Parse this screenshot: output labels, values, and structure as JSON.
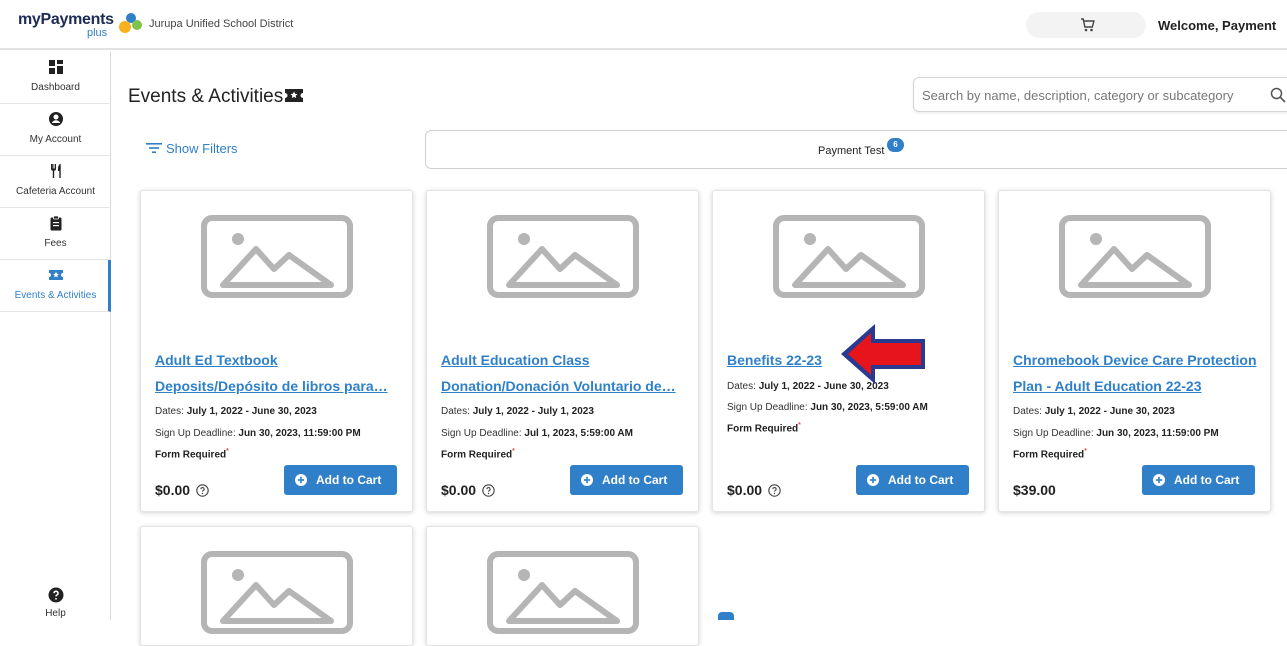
{
  "header": {
    "logo_text": "myPayments",
    "logo_sub": "plus",
    "district": "Jurupa Unified School District",
    "welcome": "Welcome, Payment",
    "cart_icon": "cart-icon"
  },
  "sidebar": {
    "items": [
      {
        "label": "Dashboard",
        "icon": "dashboard-icon"
      },
      {
        "label": "My Account",
        "icon": "user-icon"
      },
      {
        "label": "Cafeteria Account",
        "icon": "utensils-icon"
      },
      {
        "label": "Fees",
        "icon": "clipboard-icon"
      },
      {
        "label": "Events & Activities",
        "icon": "ticket-icon"
      }
    ],
    "help_label": "Help"
  },
  "main": {
    "title": "Events & Activities",
    "search_placeholder": "Search by name, description, category or subcategory",
    "filters_label": "Show Filters",
    "tab": {
      "label": "Payment Test",
      "count": "6"
    }
  },
  "cards": [
    {
      "title_line1": "Adult Ed Textbook",
      "title_line2": "Deposits/Depósito de libros para…",
      "dates_label": "Dates:",
      "dates": "July 1, 2022 - June 30, 2023",
      "deadline_label": "Sign Up Deadline:",
      "deadline": "Jun 30, 2023, 11:59:00 PM",
      "form": "Form Required",
      "price": "$0.00",
      "button": "Add to Cart"
    },
    {
      "title_line1": "Adult Education Class",
      "title_line2": "Donation/Donación Voluntario de…",
      "dates_label": "Dates:",
      "dates": "July 1, 2022 - July 1, 2023",
      "deadline_label": "Sign Up Deadline:",
      "deadline": "Jul 1, 2023, 5:59:00 AM",
      "form": "Form Required",
      "price": "$0.00",
      "button": "Add to Cart"
    },
    {
      "title_line1": "Benefits 22-23",
      "dates_label": "Dates:",
      "dates": "July 1, 2022 - June 30, 2023",
      "deadline_label": "Sign Up Deadline:",
      "deadline": "Jun 30, 2023, 5:59:00 AM",
      "form": "Form Required",
      "price": "$0.00",
      "button": "Add to Cart"
    },
    {
      "title_line1": "Chromebook Device Care Protection",
      "title_line2": "Plan - Adult Education 22-23",
      "dates_label": "Dates:",
      "dates": "July 1, 2022 - June 30, 2023",
      "deadline_label": "Sign Up Deadline:",
      "deadline": "Jun 30, 2023, 11:59:00 PM",
      "form": "Form Required",
      "price": "$39.00",
      "button": "Add to Cart"
    }
  ],
  "colors": {
    "accent": "#2f80c9",
    "arrow_fill": "#e8141b",
    "arrow_outline": "#2a3b8f"
  }
}
